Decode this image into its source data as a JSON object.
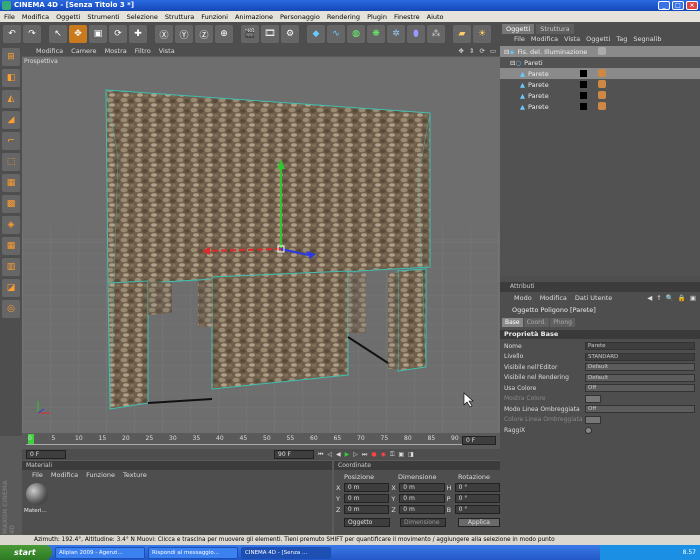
{
  "window": {
    "title": "CINEMA 4D - [Senza Titolo 3 *]"
  },
  "menubar": [
    "File",
    "Modifica",
    "Oggetti",
    "Strumenti",
    "Selezione",
    "Struttura",
    "Funzioni",
    "Animazione",
    "Personaggio",
    "Rendering",
    "Plugin",
    "Finestre",
    "Aiuto"
  ],
  "viewport": {
    "menu": [
      "Modifica",
      "Camere",
      "Mostra",
      "Filtro",
      "Vista"
    ],
    "label": "Prospettiva"
  },
  "timeline": {
    "ticks": [
      "0",
      "5",
      "10",
      "15",
      "20",
      "25",
      "30",
      "35",
      "40",
      "45",
      "50",
      "55",
      "60",
      "65",
      "70",
      "75",
      "80",
      "85",
      "90"
    ],
    "end_frame": "0 F",
    "start_field": "0 F",
    "end_field": "90 F"
  },
  "material": {
    "header": "Materiali",
    "menu": [
      "File",
      "Modifica",
      "Funzione",
      "Texture"
    ],
    "item": "Materi..."
  },
  "coordinates": {
    "header": "Coordinate",
    "columns": [
      "Posizione",
      "Dimensione",
      "Rotazione"
    ],
    "rows": [
      {
        "axis": "X",
        "pos": "0 m",
        "dim": "0 m",
        "rot_axis": "H",
        "rot": "0 °"
      },
      {
        "axis": "Y",
        "pos": "0 m",
        "dim": "0 m",
        "rot_axis": "P",
        "rot": "0 °"
      },
      {
        "axis": "Z",
        "pos": "0 m",
        "dim": "0 m",
        "rot_axis": "B",
        "rot": "0 °"
      }
    ],
    "mode": "Oggetto",
    "size_mode": "Dimensione",
    "apply": "Applica"
  },
  "objects_panel": {
    "tabs": [
      "Oggetti",
      "Struttura"
    ],
    "menu": [
      "File",
      "Modifica",
      "Vista",
      "Oggetti",
      "Tag",
      "Segnalib"
    ],
    "items": [
      {
        "name": "Fis. del. Illuminazione",
        "indent": 0,
        "selected": true
      },
      {
        "name": "Pareti",
        "indent": 1,
        "selected": false
      },
      {
        "name": "Parete",
        "indent": 2,
        "selected": true
      },
      {
        "name": "Parete",
        "indent": 2,
        "selected": false
      },
      {
        "name": "Parete",
        "indent": 2,
        "selected": false
      },
      {
        "name": "Parete",
        "indent": 2,
        "selected": false
      }
    ]
  },
  "attributes": {
    "header": "Attributi",
    "menu": [
      "Modo",
      "Modifica",
      "Dati Utente"
    ],
    "title": "Oggetto Poligono [Parete]",
    "tabs": [
      "Base",
      "Coord.",
      "Phong"
    ],
    "section": "Proprietà Base",
    "props": [
      {
        "label": "Nome",
        "value": "Parete",
        "dim": false
      },
      {
        "label": "Livello",
        "value": "STANDARD",
        "dim": false
      },
      {
        "label": "Visibile nell'Editor",
        "value": "Default",
        "dim": false
      },
      {
        "label": "Visibile nel Rendering",
        "value": "Default",
        "dim": false
      },
      {
        "label": "Usa Colore",
        "value": "Off",
        "dim": false
      },
      {
        "label": "Mostra Colore",
        "value": "",
        "dim": true
      },
      {
        "label": "Modo Linea Ombreggiata",
        "value": "Off",
        "dim": false
      },
      {
        "label": "Colore Linea Ombreggiata",
        "value": "",
        "dim": true
      },
      {
        "label": "RaggiX",
        "value": "",
        "dim": false
      }
    ]
  },
  "statusbar": {
    "text": "Azimuth: 192.4°, Altitudine: 3.4°  N    Muovi: Clicca e trascina per muovere gli elementi. Tieni premuto SHIFT per quantificare il movimento / aggiungere alla selezione in modo punto"
  },
  "taskbar": {
    "start": "start",
    "tasks": [
      "Allplan 2009 - Agenzi...",
      "Rispondi al messaggio...",
      "CINEMA 4D - [Senza ..."
    ],
    "clock": "8.57"
  },
  "brand": "MAXON CINEMA 4D",
  "colors": {
    "texture": "#7a6a58",
    "accent": "#ff9d2e",
    "selection": "#8a8a8a"
  }
}
